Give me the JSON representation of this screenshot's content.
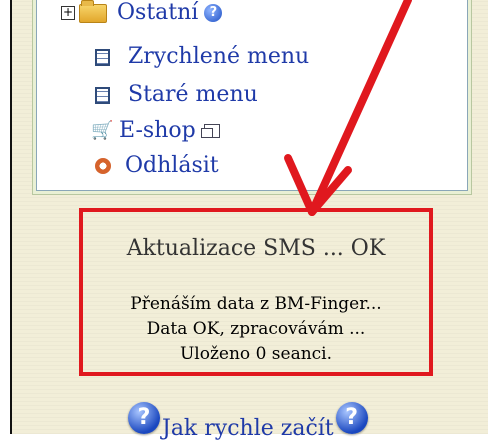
{
  "menu": {
    "items": [
      {
        "label": "Ostatní",
        "icon": "folder-icon",
        "expander": "+"
      },
      {
        "label": "Zrychlené menu",
        "icon": "page-icon"
      },
      {
        "label": "Staré menu",
        "icon": "page-icon"
      },
      {
        "label": "E-shop",
        "icon": "cart-icon"
      },
      {
        "label": "Odhlásit",
        "icon": "logout-icon"
      }
    ]
  },
  "status": {
    "title": "Aktualizace SMS ... OK",
    "lines": [
      "Přenáším data z BM-Finger...",
      "Data OK, zpracovávám ...",
      "Uloženo 0 seanci."
    ]
  },
  "help": {
    "label": "Jak rychle začít",
    "icon_glyph": "?"
  },
  "colors": {
    "link": "#1f3aa8",
    "highlight": "#e0181e",
    "panel": "#f2eed8"
  }
}
